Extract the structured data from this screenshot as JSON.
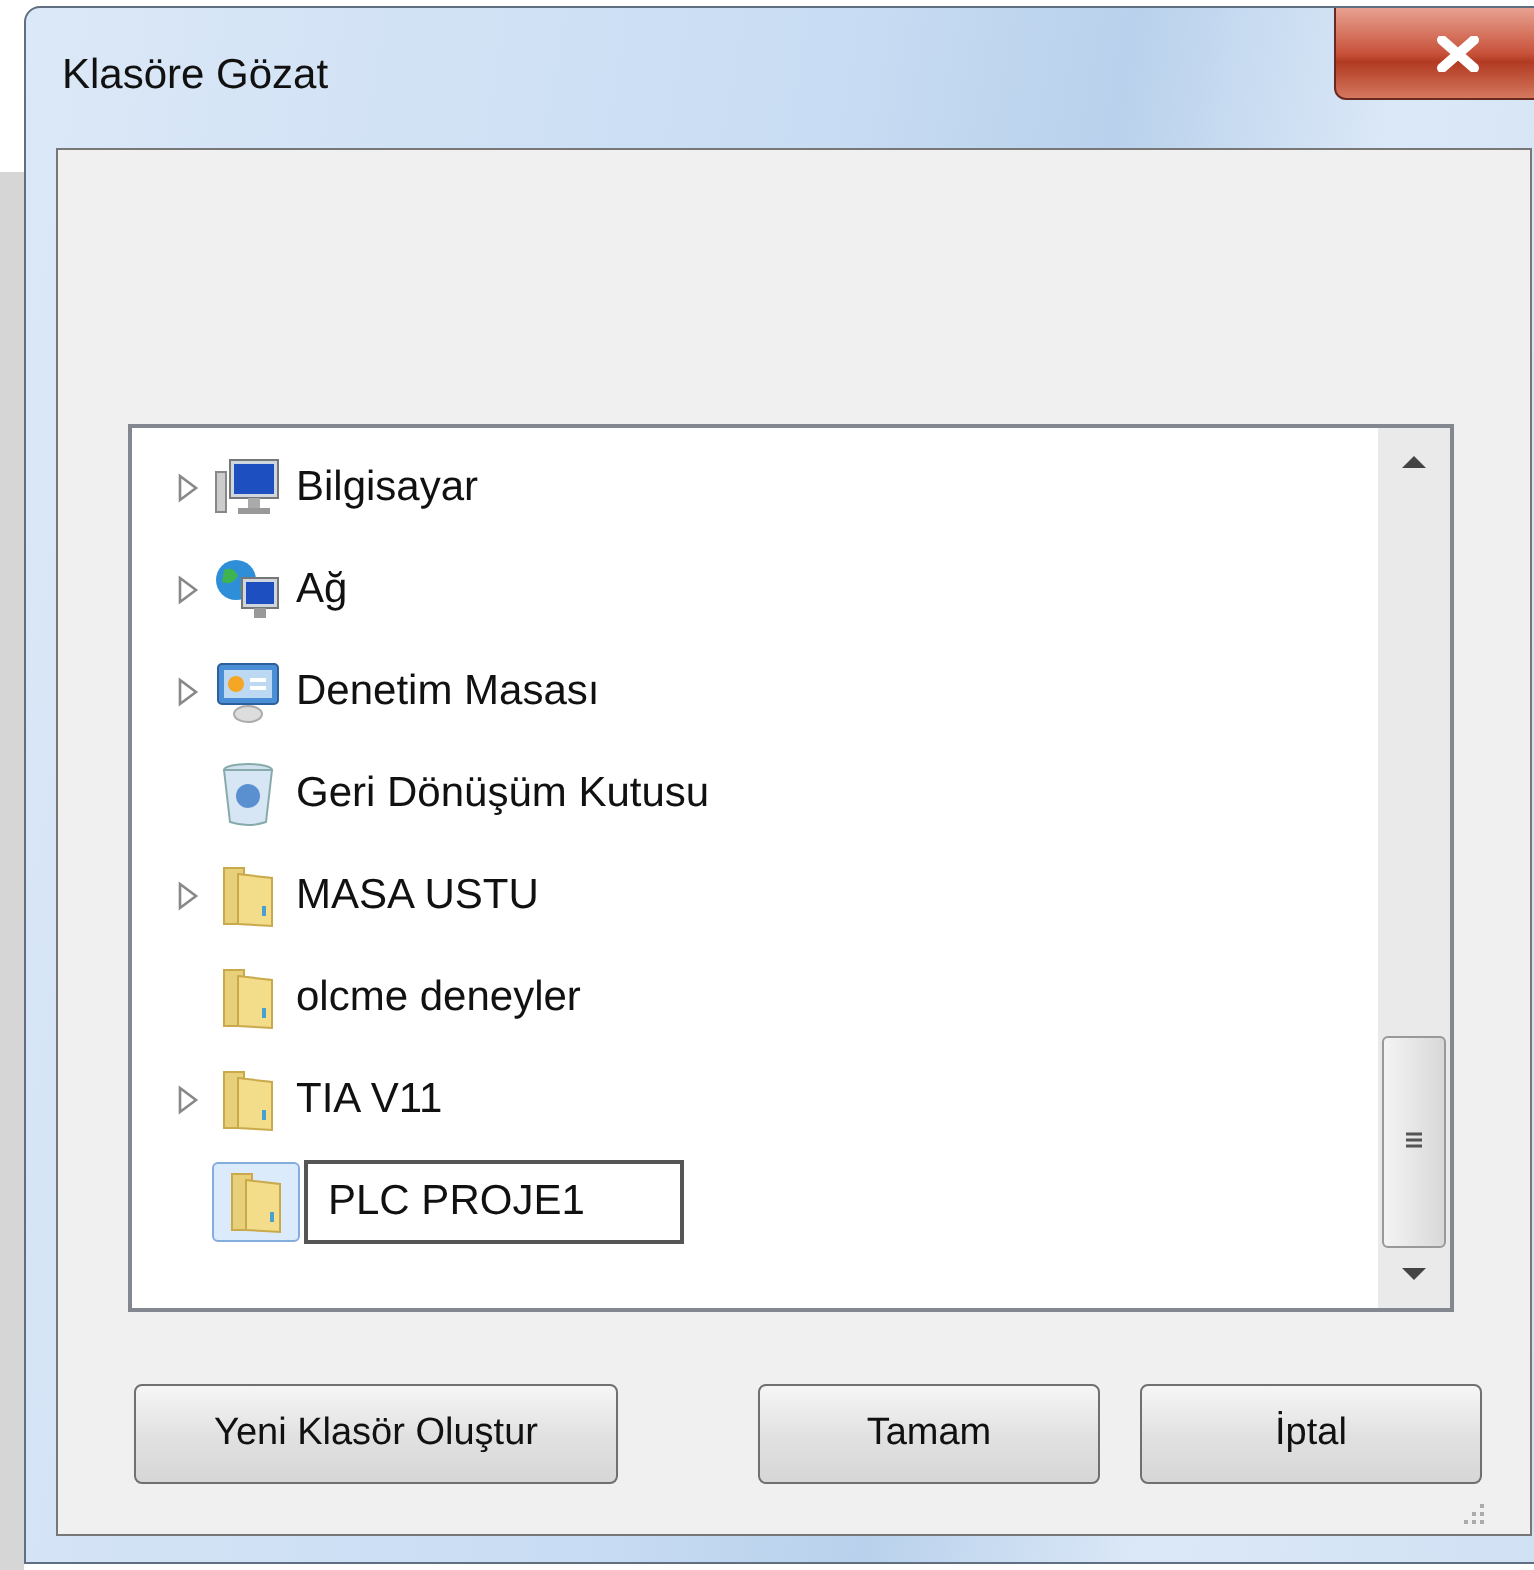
{
  "window": {
    "title": "Klasöre Gözat"
  },
  "tree": {
    "items": [
      {
        "label": "Bilgisayar",
        "kind": "computer",
        "expandable": true,
        "selected": false,
        "editing": false
      },
      {
        "label": "Ağ",
        "kind": "network",
        "expandable": true,
        "selected": false,
        "editing": false
      },
      {
        "label": "Denetim Masası",
        "kind": "control-panel",
        "expandable": true,
        "selected": false,
        "editing": false
      },
      {
        "label": "Geri Dönüşüm Kutusu",
        "kind": "recycle-bin",
        "expandable": false,
        "selected": false,
        "editing": false
      },
      {
        "label": "MASA USTU",
        "kind": "folder",
        "expandable": true,
        "selected": false,
        "editing": false
      },
      {
        "label": "olcme deneyler",
        "kind": "folder",
        "expandable": false,
        "selected": false,
        "editing": false
      },
      {
        "label": "TIA V11",
        "kind": "folder",
        "expandable": true,
        "selected": false,
        "editing": false
      },
      {
        "label": "PLC PROJE1",
        "kind": "folder",
        "expandable": false,
        "selected": true,
        "editing": true
      }
    ]
  },
  "buttons": [
    "Yeni Klasör Oluştur",
    "Tamam",
    "İptal"
  ]
}
